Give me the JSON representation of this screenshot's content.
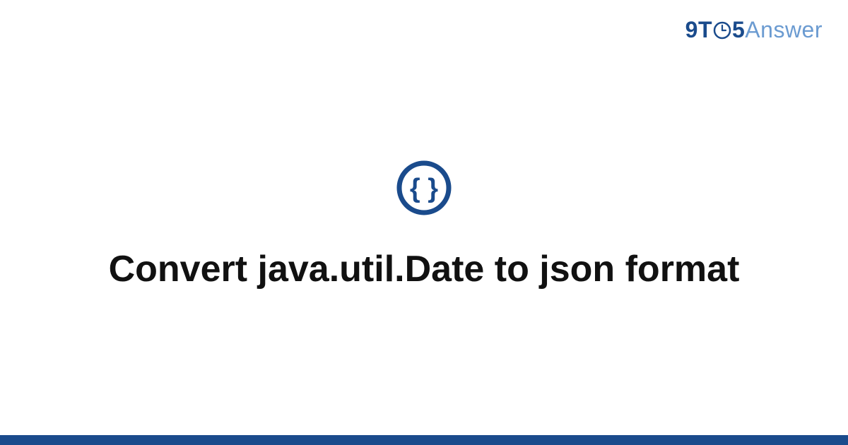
{
  "brand": {
    "part1": "9",
    "part2": "T",
    "part3": "5",
    "part4": "Answer"
  },
  "icon": {
    "name": "curly-braces-json"
  },
  "title": "Convert java.util.Date to json format",
  "colors": {
    "primary": "#1a4b8c",
    "secondary": "#6b9bd1"
  }
}
